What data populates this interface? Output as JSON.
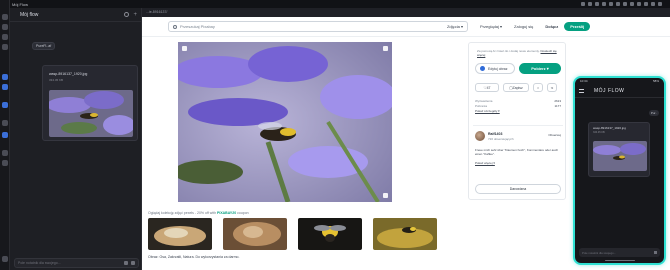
{
  "window": {
    "title": "Mój Flow",
    "url": "...ie-8916137/"
  },
  "flow": {
    "title": "Mój flow",
    "chip": "PureFl..af",
    "card": {
      "filename": "wasp-8916137_1920.jpg",
      "size": "334.45 KB"
    },
    "input_placeholder": "Pole notatnik dla swojego..."
  },
  "site": {
    "search_placeholder": "Przeszukaj Pixabay",
    "search_filter": "Zdjęcia ▾",
    "nav": [
      "Przeglądaj ▾",
      "Zaloguj się",
      "Dołącz"
    ],
    "cta": "Prześlij",
    "side": {
      "hint": "Za pomocą AI zmień tło i dodaj nowe elementy.",
      "hint_link": "Dowiedz się więcej",
      "edit_label": "Edytuj obraz",
      "download_label": "Pobierz ▾",
      "likes": "47",
      "save_label": "Zapisz",
      "meta": [
        {
          "k": "Wyświetlenia",
          "v": "2613"
        },
        {
          "k": "Pobrania",
          "v": "1177"
        }
      ],
      "more_link": "Pokaż szczegóły ▾",
      "author": {
        "name": "Ralf1403",
        "sub": "720 obserwujących",
        "follow": "Obserwuj"
      },
      "author_text": "Freue mich sehr über \"Daumen hoch\", Kommentare oder auch einen \"Kaffee\".",
      "author_more": "Pokaż więcej ▾",
      "donate": "Darowizna"
    },
    "caption_prefix": "Oglądaj kolekcję zdjęć pexels - 20% off with",
    "caption_code": "PIXABAY20",
    "caption_suffix": "coupon",
    "description": "Obraz: Osa, Zakrzatli, Natura. Do wykorzystania za darmo."
  },
  "phone": {
    "time": "10:34",
    "battery": "58%",
    "title": "MÓJ FLOW",
    "chip": "Pur..",
    "card": {
      "filename": "wasp-8916137_1920.jpg",
      "size": "334.45 KB"
    },
    "input_placeholder": "Pole notatnik dla swojego..."
  }
}
